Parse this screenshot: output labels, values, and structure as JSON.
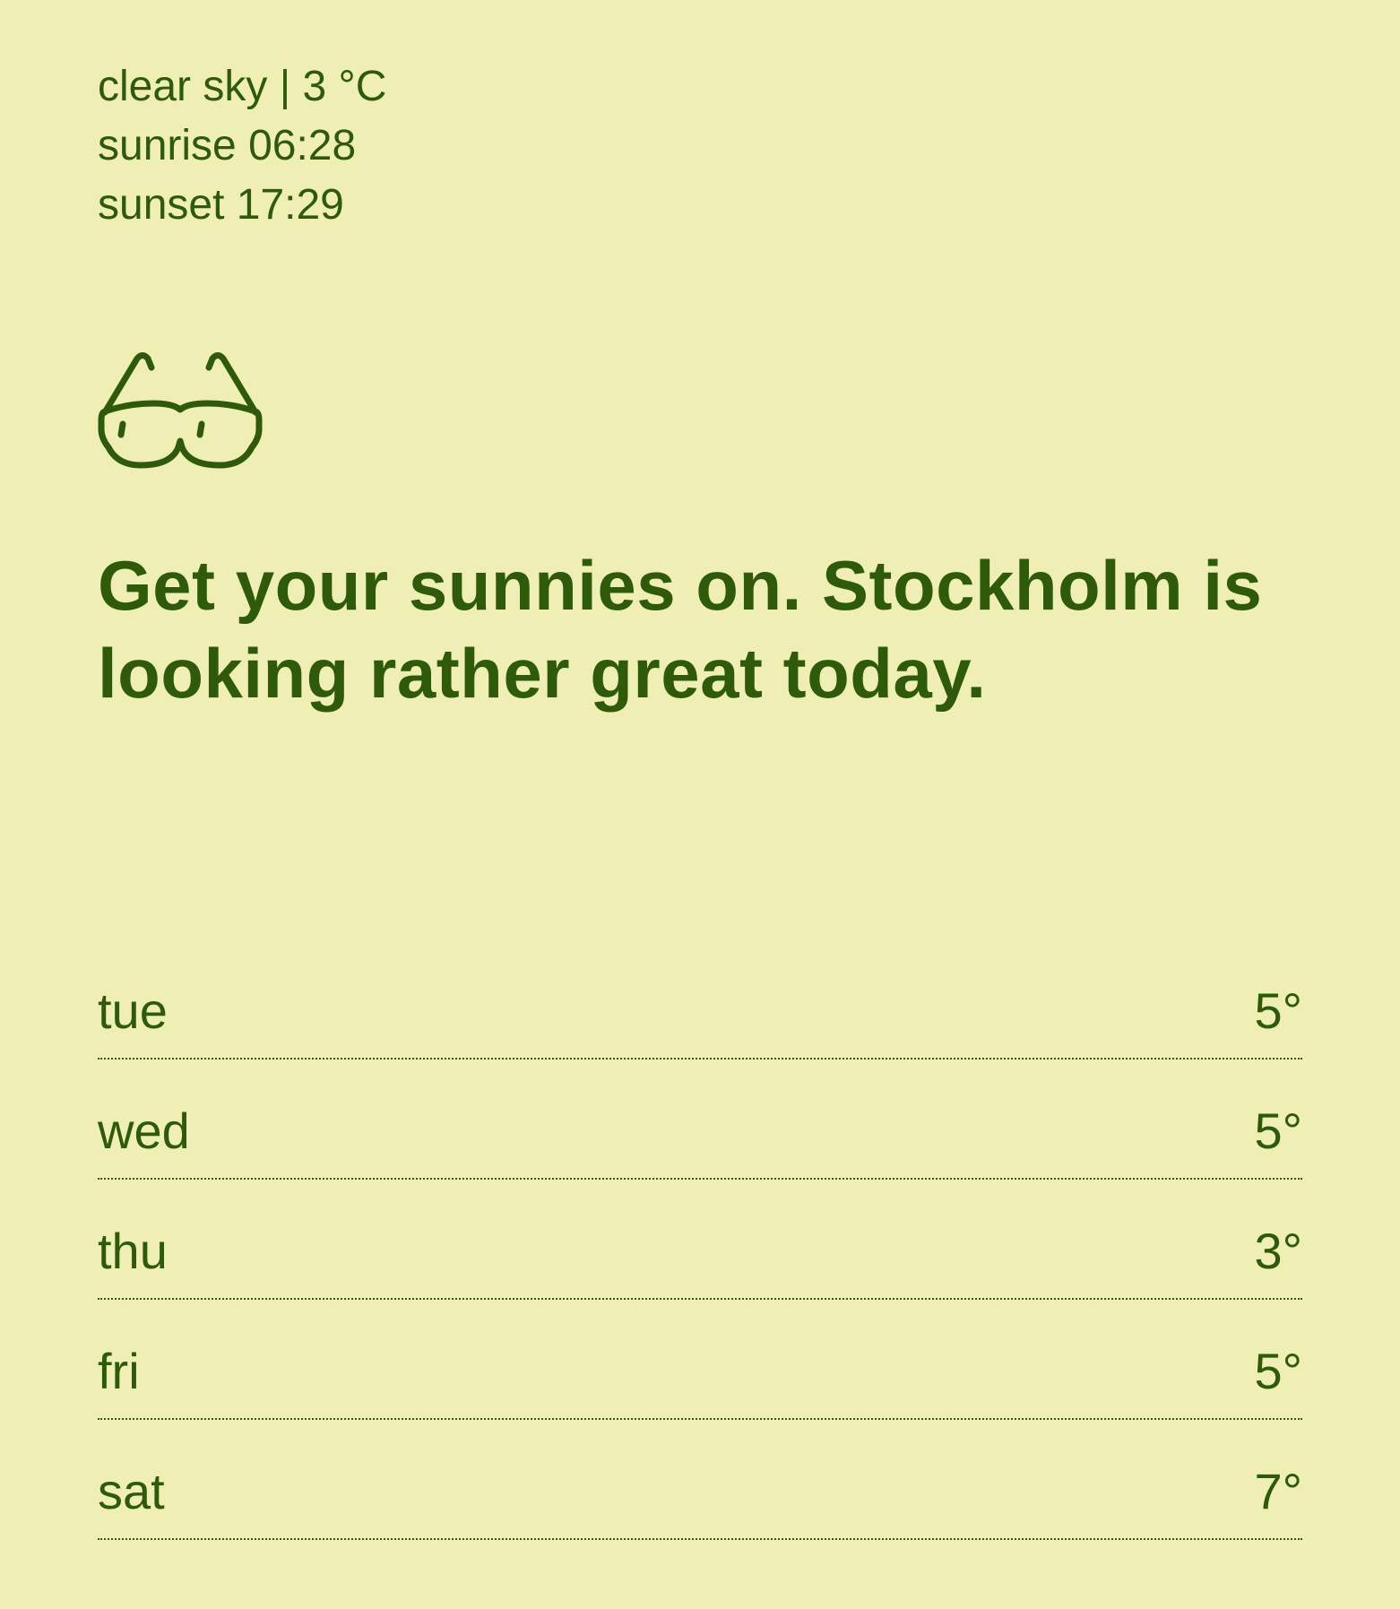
{
  "current": {
    "summary": "clear sky | 3 °C",
    "sunrise": "sunrise 06:28",
    "sunset": "sunset 17:29"
  },
  "icon": "sunglasses-icon",
  "headline": "Get your sunnies on. Stockholm is looking rather great today.",
  "forecast": [
    {
      "day": "tue",
      "temp": "5°"
    },
    {
      "day": "wed",
      "temp": "5°"
    },
    {
      "day": "thu",
      "temp": "3°"
    },
    {
      "day": "fri",
      "temp": "5°"
    },
    {
      "day": "sat",
      "temp": "7°"
    }
  ],
  "colors": {
    "background": "#efeeb4",
    "text": "#2e5a09"
  }
}
